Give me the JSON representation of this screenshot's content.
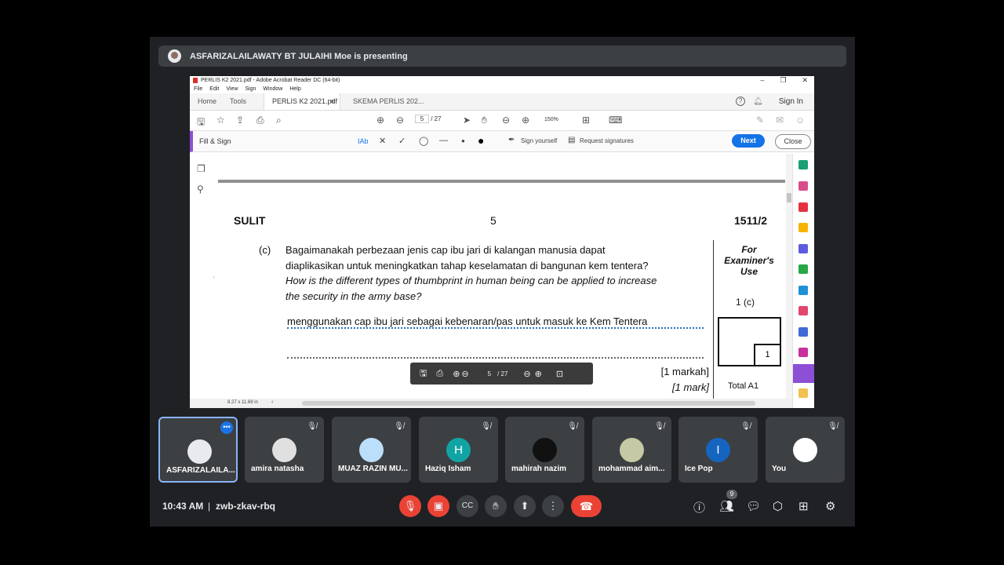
{
  "presenter": {
    "text": "ASFARIZALAILAWATY BT JULAIHI Moe is presenting"
  },
  "acrobat": {
    "title": "PERLIS K2 2021.pdf - Adobe Acrobat Reader DC (64-bit)",
    "menu": [
      "File",
      "Edit",
      "View",
      "Sign",
      "Window",
      "Help"
    ],
    "tabs": {
      "home": "Home",
      "tools": "Tools",
      "active": "PERLIS K2 2021.pdf",
      "second": "SKEMA PERLIS 202..."
    },
    "signin": "Sign In",
    "page_current": "5",
    "page_total": "/ 27",
    "zoom": "150%",
    "fill_sign": {
      "label": "Fill & Sign",
      "text_tool": "IAb",
      "sign_yourself": "Sign yourself",
      "request_signatures": "Request signatures",
      "next": "Next",
      "close": "Close"
    },
    "page_size": "8.27 x 11.69 in"
  },
  "document": {
    "sulit": "SULIT",
    "page_number": "5",
    "code": "1511/2",
    "question_label": "(c)",
    "question_ms_line1": "Bagaimanakah  perbezaan  jenis  cap ibu jari  di kalangan manusia dapat",
    "question_ms_line2": "diaplikasikan untuk  meningkatkan  tahap keselamatan di bangunan kem  tentera?",
    "question_en_line1": "How is the different types of thumbprint in human being can be applied to increase",
    "question_en_line2": "the security in the army base?",
    "answer": "menggunakan cap ibu jari sebagai kebenaran/pas untuk masuk ke Kem Tentera",
    "mark_ms": "[1 markah]",
    "mark_en": "[1 mark]",
    "examiner_use": "For Examiner's Use",
    "question_ref": "1 (c)",
    "box_mark": "1",
    "total": "Total A1"
  },
  "float_toolbar": {
    "page": "5",
    "total": "/ 27"
  },
  "participants": [
    {
      "name": "ASFARIZALAILA...",
      "color": "#e8eaed"
    },
    {
      "name": "amira natasha",
      "color": "#e0e0e0"
    },
    {
      "name": "MUAZ RAZIN MU...",
      "color": "#bbdefb"
    },
    {
      "name": "Haziq Isham",
      "initial": "H",
      "color": "#12a4a5"
    },
    {
      "name": "mahirah nazim",
      "color": "#111111"
    },
    {
      "name": "mohammad aim...",
      "color": "#c5c9a4"
    },
    {
      "name": "Ice Pop",
      "initial": "I",
      "color": "#1565c0"
    },
    {
      "name": "You",
      "color": "#ffffff"
    }
  ],
  "footer": {
    "time": "10:43 AM",
    "separator": "|",
    "meeting_code": "zwb-zkav-rbq",
    "people_count": "9"
  },
  "colors": {
    "meet_bg": "#202124",
    "tile_bg": "#3c4043",
    "red": "#ea4335",
    "accent": "#1a73e8"
  }
}
